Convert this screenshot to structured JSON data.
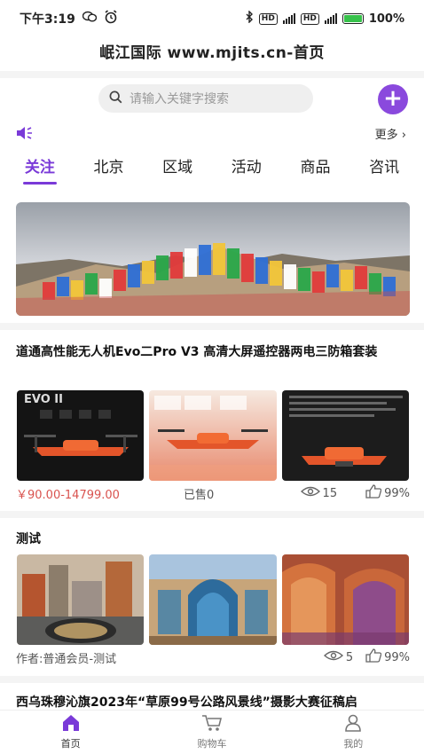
{
  "status": {
    "time": "下午3:19",
    "battery": "100%",
    "net_a": "HD",
    "net_b": "HD"
  },
  "header": {
    "title": "岷江国际  www.mjits.cn-首页"
  },
  "search": {
    "placeholder": "请输入关键字搜索"
  },
  "notice": {
    "more_label": "更多"
  },
  "tabs": [
    {
      "label": "关注"
    },
    {
      "label": "北京"
    },
    {
      "label": "区域"
    },
    {
      "label": "活动"
    },
    {
      "label": "商品"
    },
    {
      "label": "咨讯"
    }
  ],
  "banner": {
    "alt": "prayer flags banner"
  },
  "posts": [
    {
      "title": "道通高性能无人机Evo二Pro V3 高清大屏遥控器两电三防箱套装",
      "price": "￥90.00-14799.00",
      "sold": "已售0",
      "views": "15",
      "likes": "99%"
    },
    {
      "title": "测试",
      "author": "作者:普通会员-测试",
      "views": "5",
      "likes": "99%"
    },
    {
      "title": "西乌珠穆沁旗2023年“草原99号公路风景线”摄影大赛征稿启"
    }
  ],
  "bottom_nav": [
    {
      "label": "首页"
    },
    {
      "label": "购物车"
    },
    {
      "label": "我的"
    }
  ],
  "colors": {
    "accent": "#7a3ad8",
    "price": "#d9534f",
    "battery_fill": "#37c24b"
  }
}
